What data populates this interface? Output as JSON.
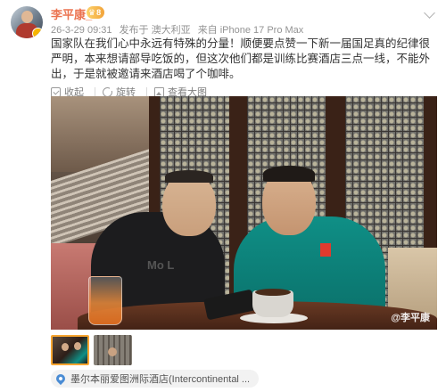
{
  "post": {
    "username": "李平康_",
    "vip_level": "8",
    "meta": {
      "date": "26-3-29 09:31",
      "published_in": "发布于 澳大利亚",
      "source": "来自 iPhone 17 Pro Max"
    },
    "text": "国家队在我们心中永远有特殊的分量！顺便要点赞一下新一届国足真的纪律很严明，本来想请部导吃饭的，但这次他们都是训练比赛酒店三点一线，不能外出，于是就被邀请来酒店喝了个咖啡。",
    "actions": {
      "favorite": "收起",
      "rotate": "旋转",
      "view_large": "查看大图"
    },
    "photo": {
      "shirt_text": "Mo   L",
      "watermark": "@李平康"
    },
    "thumbnail_count": 2,
    "active_thumbnail": 1,
    "location": "墨尔本丽爱图洲际酒店(Intercontinental ..."
  },
  "colors": {
    "username": "#eb7350",
    "vip_badge": "#f2a33a",
    "meta_text": "#939393",
    "active_thumb_border": "#f7a530",
    "location_pin": "#4a8cd4"
  }
}
